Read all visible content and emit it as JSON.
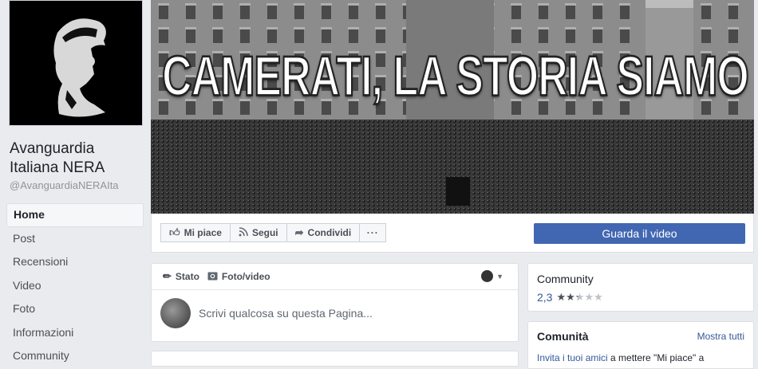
{
  "page": {
    "name": "Avanguardia Italiana NERA",
    "handle": "@AvanguardiaNERAIta"
  },
  "nav": [
    "Home",
    "Post",
    "Recensioni",
    "Video",
    "Foto",
    "Informazioni",
    "Community"
  ],
  "cover": {
    "title": "CAMERATI, LA STORIA SIAMO NOI."
  },
  "actions": {
    "like": "Mi piace",
    "follow": "Segui",
    "share": "Condividi",
    "more": "···",
    "cta": "Guarda il video"
  },
  "composer": {
    "tab_status": "Stato",
    "tab_photo": "Foto/video",
    "placeholder": "Scrivi qualcosa su questa Pagina..."
  },
  "community_card": {
    "title": "Community",
    "rating": "2,3",
    "stars_filled": 2.3,
    "stars_total": 5
  },
  "comunita_card": {
    "title": "Comunità",
    "link": "Mostra tutti",
    "line_link": "Invita i tuoi amici",
    "line_rest": " a mettere \"Mi piace\" a"
  },
  "colors": {
    "brand": "#4267b2",
    "link": "#365899",
    "background": "#e9ebee"
  }
}
